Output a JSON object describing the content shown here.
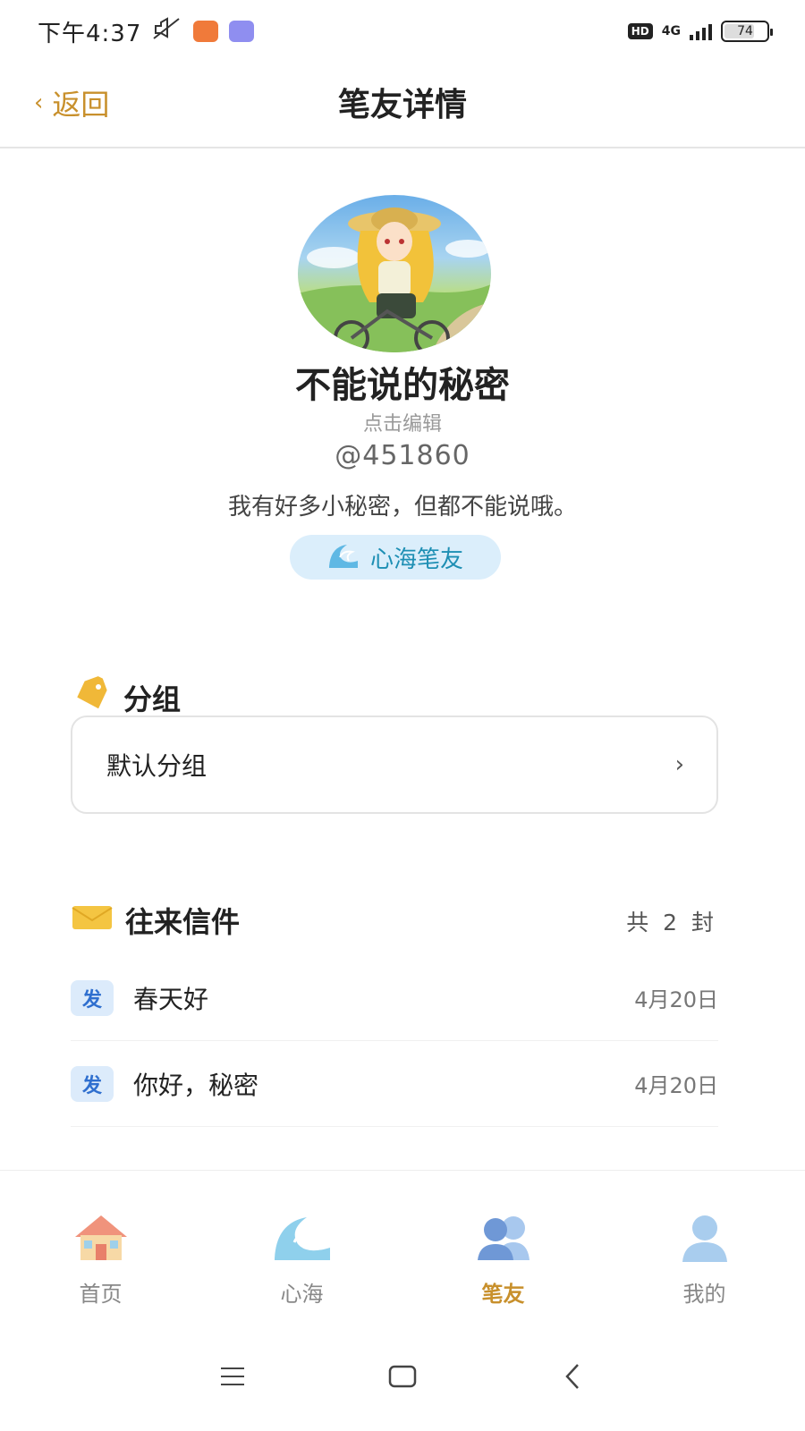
{
  "status_bar": {
    "time": "下午4:37",
    "network": "4G",
    "hd": "HD",
    "battery": "74",
    "battery_level": 0.74
  },
  "header": {
    "back_label": "返回",
    "title": "笔友详情"
  },
  "profile": {
    "nickname": "不能说的秘密",
    "edit_hint": "点击编辑",
    "user_id": "@451860",
    "bio": "我有好多小秘密，但都不能说哦。",
    "tag": "心海笔友"
  },
  "group_section": {
    "title": "分组",
    "value": "默认分组"
  },
  "letters_section": {
    "title": "往来信件",
    "count": "共 2 封",
    "items": [
      {
        "badge": "发",
        "title": "春天好",
        "date": "4月20日"
      },
      {
        "badge": "发",
        "title": "你好，秘密",
        "date": "4月20日"
      }
    ]
  },
  "tabs": [
    {
      "label": "首页",
      "icon": "home-icon",
      "active": false
    },
    {
      "label": "心海",
      "icon": "wave-icon",
      "active": false
    },
    {
      "label": "笔友",
      "icon": "penpals-icon",
      "active": true
    },
    {
      "label": "我的",
      "icon": "profile-icon",
      "active": false
    }
  ],
  "colors": {
    "accent": "#c8902c",
    "badge_bg": "#dcebfb",
    "badge_text": "#2f6fcf",
    "tag_bg": "#dbeefb",
    "tag_text": "#1e8fb4"
  }
}
